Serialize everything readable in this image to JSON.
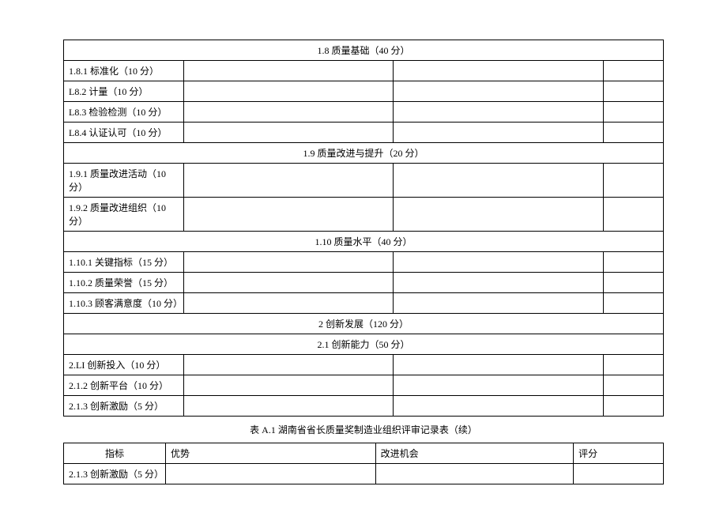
{
  "sections": {
    "s18": {
      "header": "1.8 质量基础（40 分）",
      "items": [
        "1.8.1 标准化（10 分）",
        "L8.2 计量（10 分）",
        "L8.3 检验检测（10 分）",
        "L8.4 认证认可（10 分）"
      ]
    },
    "s19": {
      "header": "1.9 质量改进与提升（20 分）",
      "items": [
        "1.9.1 质量改进活动（10 分）",
        "1.9.2 质量改进组织（10 分）"
      ]
    },
    "s110": {
      "header": "1.10 质量水平（40 分）",
      "items": [
        "1.10.1 关键指标（15 分）",
        "1.10.2 质量荣誉（15 分）",
        "1.10.3 顾客满意度（10 分）"
      ]
    },
    "s2": {
      "header": "2 创新发展（120 分）"
    },
    "s21": {
      "header": "2.1 创新能力（50 分）",
      "items": [
        "2.LI 创新投入（10 分）",
        "2.1.2 创新平台（10 分）",
        "2.1.3 创新激励（5 分）"
      ]
    }
  },
  "caption": "表 A.1 湖南省省长质量奖制造业组织评审记录表（续）",
  "table2": {
    "headers": {
      "col1": "指标",
      "col2": "优势",
      "col3": "改进机会",
      "col4": "评分"
    },
    "row1": "2.1.3 创新激励（5 分）"
  }
}
